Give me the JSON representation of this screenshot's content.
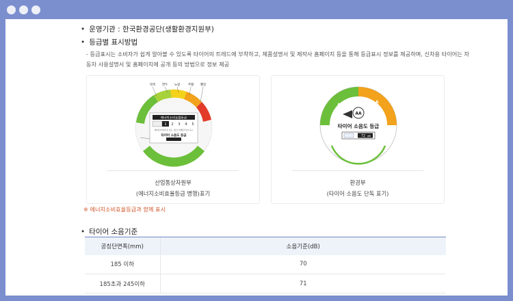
{
  "window": {
    "controls": [
      "close",
      "minimize",
      "maximize"
    ]
  },
  "operator": {
    "text": "운영기관 : 한국환경공단(생활환경지원부)"
  },
  "grade_section": {
    "title": "등급별 표시방법",
    "desc_line1": "- 등급표시는 소비자가 쉽게 알아볼 수 있도록 타이어의 트레드에 부착하고, 제품설명서 및 제작사 홈페이지 등을 통해 등급표시 정보를 제공하며, 신차용 타이어는 자",
    "desc_line2": "동차 사용설명서 및 홈페이지에 공개 등의 방법으로 정보 제공"
  },
  "label_left": {
    "top_labels": [
      "북쪽",
      "연두",
      "노랑",
      "주황",
      "빨강"
    ],
    "title": "에너지소비효율등급",
    "grades": [
      "1",
      "2",
      "3",
      "4",
      "5"
    ],
    "small_text": "에너지소비효율 및 소음 · 젖은노면제동력 정보 표시",
    "noise_title": "타이어 소음도 등급",
    "side_note": "",
    "caption1": "산업통상자원부",
    "caption2": "(에너지소비효율등급 병행)표기"
  },
  "label_right": {
    "grade_left": "AA",
    "grade_right": "A",
    "top_small": "",
    "center_badge": "AA",
    "title": "타이어 소음도 등급",
    "db_value": "72",
    "db_unit": "dB",
    "bottom_small": "",
    "caption1": "환경부",
    "caption2": "(타이어 소음도 단독 표기)"
  },
  "note": "※ 에너지소비효율등급과 함께 표시",
  "noise_section": {
    "title": "타이어 소음기준",
    "headers": [
      "공칭단면폭(mm)",
      "소음기준(dB)"
    ],
    "rows": [
      [
        "185 이하",
        "70"
      ],
      [
        "185초과 245이하",
        "71"
      ]
    ]
  },
  "colors": {
    "frame": "#7b8fcf",
    "accent": "#6f86c4",
    "green": "#6cbf3a",
    "orange": "#f2a21b",
    "red": "#e23b2a",
    "yellow": "#f3d21b"
  }
}
